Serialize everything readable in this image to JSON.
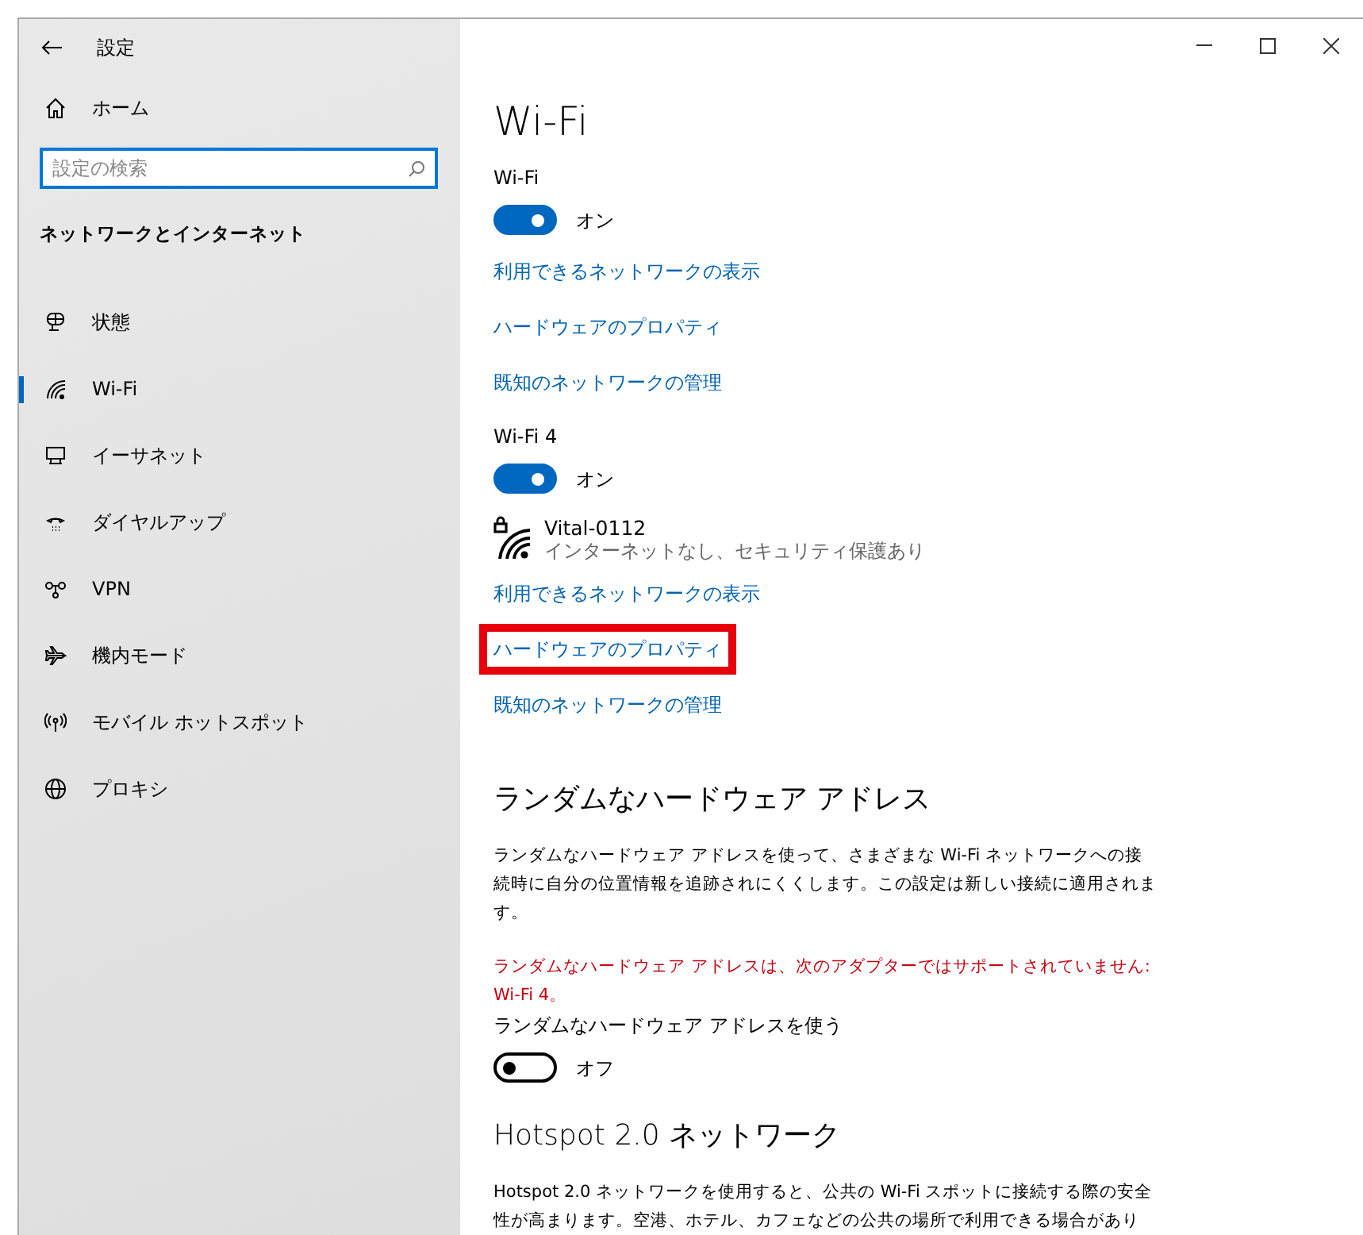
{
  "window": {
    "title": "設定"
  },
  "sidebar": {
    "home": "ホーム",
    "search": {
      "placeholder": "設定の検索"
    },
    "section": "ネットワークとインターネット",
    "items": [
      {
        "label": "状態",
        "selected": false
      },
      {
        "label": "Wi-Fi",
        "selected": true
      },
      {
        "label": "イーサネット",
        "selected": false
      },
      {
        "label": "ダイヤルアップ",
        "selected": false
      },
      {
        "label": "VPN",
        "selected": false
      },
      {
        "label": "機内モード",
        "selected": false
      },
      {
        "label": "モバイル ホットスポット",
        "selected": false
      },
      {
        "label": "プロキシ",
        "selected": false
      }
    ]
  },
  "main": {
    "title": "Wi-Fi",
    "adapters": [
      {
        "label": "Wi-Fi",
        "toggle": {
          "on": true,
          "text": "オン"
        },
        "links": [
          {
            "text": "利用できるネットワークの表示",
            "highlighted": false
          },
          {
            "text": "ハードウェアのプロパティ",
            "highlighted": false
          },
          {
            "text": "既知のネットワークの管理",
            "highlighted": false
          }
        ]
      },
      {
        "label": "Wi-Fi 4",
        "toggle": {
          "on": true,
          "text": "オン"
        },
        "network": {
          "name": "Vital-0112",
          "status": "インターネットなし、セキュリティ保護あり"
        },
        "links": [
          {
            "text": "利用できるネットワークの表示",
            "highlighted": false
          },
          {
            "text": "ハードウェアのプロパティ",
            "highlighted": true
          },
          {
            "text": "既知のネットワークの管理",
            "highlighted": false
          }
        ]
      }
    ],
    "random_address": {
      "heading": "ランダムなハードウェア アドレス",
      "description": "ランダムなハードウェア アドレスを使って、さまざまな Wi-Fi ネットワークへの接続時に自分の位置情報を追跡されにくくします。この設定は新しい接続に適用されます。",
      "warning": "ランダムなハードウェア アドレスは、次のアダプターではサポートされていません: Wi-Fi 4。",
      "toggle_label": "ランダムなハードウェア アドレスを使う",
      "toggle": {
        "on": false,
        "text": "オフ"
      }
    },
    "hotspot": {
      "heading": "Hotspot 2.0 ネットワーク",
      "description": "Hotspot 2.0 ネットワークを使用すると、公共の Wi-Fi スポットに接続する際の安全性が高まります。空港、ホテル、カフェなどの公共の場所で利用できる場合があり"
    }
  }
}
